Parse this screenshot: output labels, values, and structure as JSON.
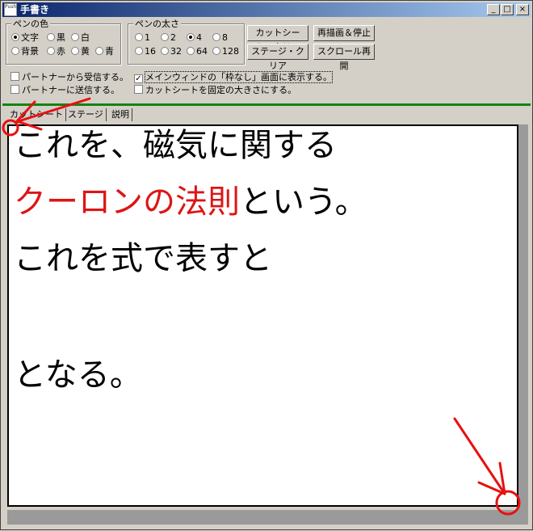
{
  "window": {
    "title": "手書き",
    "icon_text": "Push",
    "controls": {
      "minimize": "_",
      "maximize": "□",
      "close": "×"
    }
  },
  "pen_color": {
    "label": "ペンの色",
    "options": [
      "文字",
      "黒",
      "白",
      "背景",
      "赤",
      "黄",
      "青"
    ],
    "selected": "文字"
  },
  "pen_width": {
    "label": "ペンの太さ",
    "options": [
      "1",
      "2",
      "4",
      "8",
      "16",
      "32",
      "64",
      "128"
    ],
    "selected": "4"
  },
  "buttons": {
    "cutsheet_clear": "カットシート・クリア",
    "redraw_stop": "再描画＆停止",
    "stage_clear": "ステージ・クリア",
    "scroll_resume": "スクロール再開"
  },
  "checkboxes": [
    {
      "label": "パートナーから受信する。",
      "checked": false
    },
    {
      "label": "メインウィンドの「枠なし」画面に表示する。",
      "checked": true
    },
    {
      "label": "パートナーに送信する。",
      "checked": false
    },
    {
      "label": "カットシートを固定の大きさにする。",
      "checked": false
    }
  ],
  "tabs": [
    "カットシート",
    "ステージ",
    "説明"
  ],
  "canvas": {
    "lines": [
      {
        "segments": [
          {
            "text": "これを、磁気に関する",
            "color": "#000000"
          }
        ]
      },
      {
        "segments": [
          {
            "text": "クーロンの法則",
            "color": "#dd1515"
          },
          {
            "text": "という。",
            "color": "#000000"
          }
        ]
      },
      {
        "segments": [
          {
            "text": "これを式で表すと",
            "color": "#000000"
          }
        ]
      },
      {
        "segments": [
          {
            "text": "となる。",
            "color": "#000000"
          }
        ]
      }
    ]
  },
  "annotations": {
    "color": "#e81010"
  }
}
